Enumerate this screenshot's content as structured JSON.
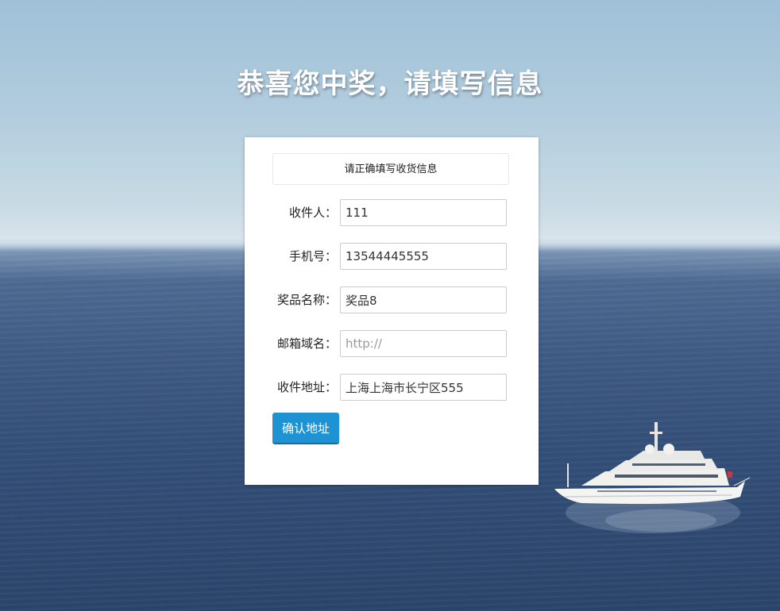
{
  "page": {
    "headline": "恭喜您中奖，请填写信息"
  },
  "form": {
    "notice": "请正确填写收货信息",
    "fields": [
      {
        "label": "收件人：",
        "value": "111",
        "placeholder": ""
      },
      {
        "label": "手机号：",
        "value": "13544445555",
        "placeholder": ""
      },
      {
        "label": "奖品名称：",
        "value": "奖品8",
        "placeholder": ""
      },
      {
        "label": "邮箱域名：",
        "value": "",
        "placeholder": "http://"
      },
      {
        "label": "收件地址：",
        "value": "上海上海市长宁区555",
        "placeholder": ""
      }
    ],
    "submit_label": "确认地址"
  },
  "colors": {
    "accent": "#1e93d3",
    "card_background": "#ffffff"
  },
  "background": {
    "icon": "yacht-on-sea-image"
  }
}
